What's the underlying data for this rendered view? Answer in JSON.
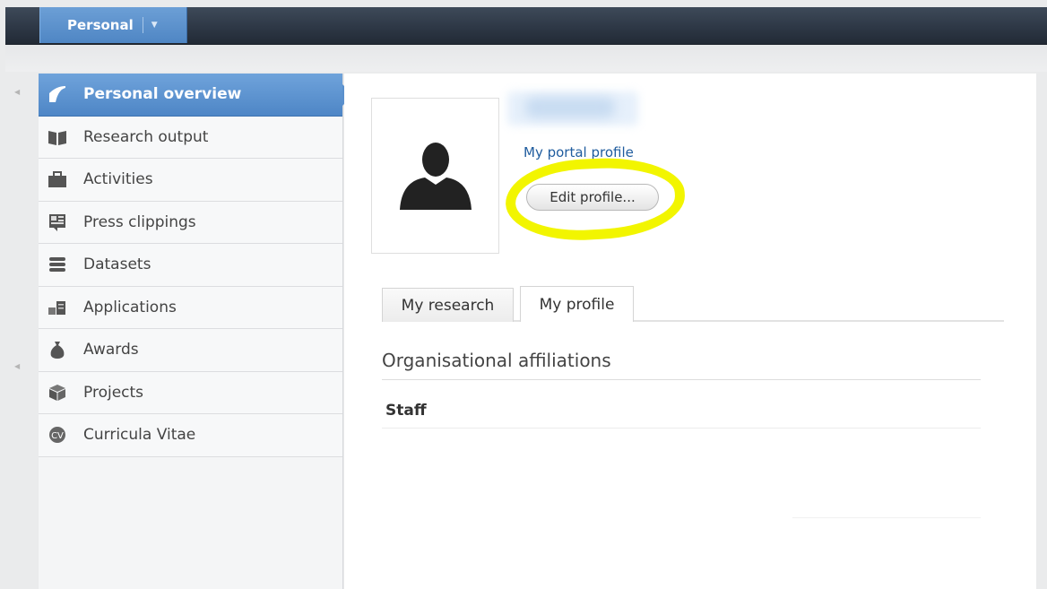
{
  "topbar": {
    "tab_label": "Personal",
    "dropdown_glyph": "▼"
  },
  "sidebar": {
    "items": [
      {
        "label": "Personal overview",
        "icon": "overview-icon",
        "active": true
      },
      {
        "label": "Research output",
        "icon": "book-icon"
      },
      {
        "label": "Activities",
        "icon": "briefcase-icon"
      },
      {
        "label": "Press clippings",
        "icon": "newspaper-icon"
      },
      {
        "label": "Datasets",
        "icon": "database-icon"
      },
      {
        "label": "Applications",
        "icon": "applications-icon"
      },
      {
        "label": "Awards",
        "icon": "money-bag-icon"
      },
      {
        "label": "Projects",
        "icon": "cube-icon"
      },
      {
        "label": "Curricula Vitae",
        "icon": "cv-icon"
      }
    ]
  },
  "profile": {
    "portal_link": "My portal profile",
    "edit_button": "Edit profile..."
  },
  "tabs": [
    {
      "label": "My research",
      "active": false
    },
    {
      "label": "My profile",
      "active": true
    }
  ],
  "content": {
    "section_title": "Organisational affiliations",
    "affiliation": "Staff"
  },
  "colors": {
    "accent": "#5b90cc",
    "highlight": "#f2f500",
    "link": "#1f5c9e"
  }
}
